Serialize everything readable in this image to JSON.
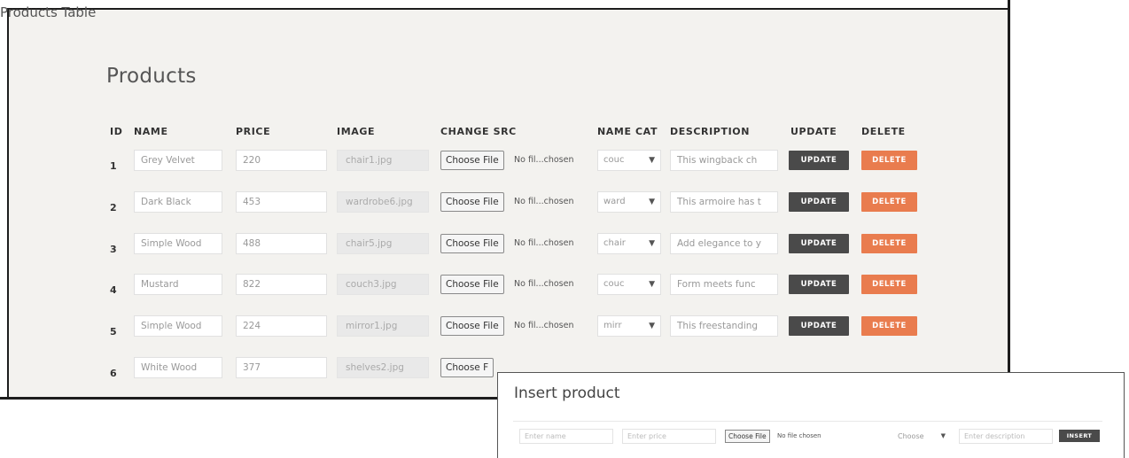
{
  "window": {
    "title": "Products Table"
  },
  "products": {
    "heading": "Products",
    "columns": {
      "id": "ID",
      "name": "NAME",
      "price": "PRICE",
      "image": "IMAGE",
      "change_src": "CHANGE SRC",
      "name_cat": "NAME CAT",
      "description": "DESCRIPTION",
      "update": "UPDATE",
      "delete": "DELETE"
    },
    "rows": [
      {
        "id": "1",
        "name": "Grey Velvet",
        "price": "220",
        "image": "chair1.jpg",
        "file_button": "Choose File",
        "file_status": "No fil...chosen",
        "category": "couc",
        "description": "This wingback ch",
        "update": "UPDATE",
        "delete": "DELETE"
      },
      {
        "id": "2",
        "name": "Dark Black",
        "price": "453",
        "image": "wardrobe6.jpg",
        "file_button": "Choose File",
        "file_status": "No fil...chosen",
        "category": "ward",
        "description": "This armoire has t",
        "update": "UPDATE",
        "delete": "DELETE"
      },
      {
        "id": "3",
        "name": "Simple Wood",
        "price": "488",
        "image": "chair5.jpg",
        "file_button": "Choose File",
        "file_status": "No fil...chosen",
        "category": "chair",
        "description": "Add elegance to y",
        "update": "UPDATE",
        "delete": "DELETE"
      },
      {
        "id": "4",
        "name": "Mustard",
        "price": "822",
        "image": "couch3.jpg",
        "file_button": "Choose File",
        "file_status": "No fil...chosen",
        "category": "couc",
        "description": "Form meets func",
        "update": "UPDATE",
        "delete": "DELETE"
      },
      {
        "id": "5",
        "name": "Simple Wood",
        "price": "224",
        "image": "mirror1.jpg",
        "file_button": "Choose File",
        "file_status": "No fil...chosen",
        "category": "mirr",
        "description": "This freestanding",
        "update": "UPDATE",
        "delete": "DELETE"
      },
      {
        "id": "6",
        "name": "White Wood",
        "price": "377",
        "image": "shelves2.jpg",
        "file_button": "Choose F",
        "file_status": "",
        "category": "",
        "description": "",
        "update": "",
        "delete": ""
      }
    ]
  },
  "insert": {
    "title": "Insert product",
    "name_placeholder": "Enter name",
    "price_placeholder": "Enter price",
    "file_button": "Choose File",
    "file_status": "No file chosen",
    "category_select": "Choose",
    "description_placeholder": "Enter description",
    "insert_button": "INSERT"
  },
  "colors": {
    "update_button": "#4a4a4a",
    "delete_button": "#e97c4e",
    "panel_bg": "#f3f2ef"
  }
}
